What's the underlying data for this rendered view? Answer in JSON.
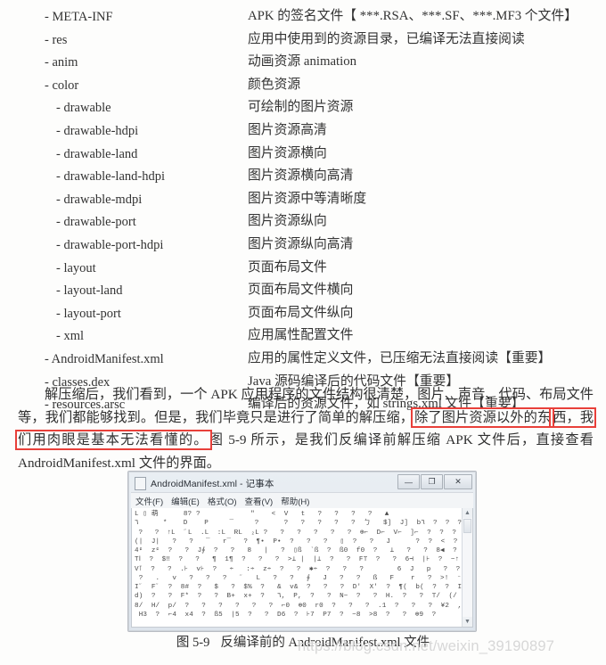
{
  "document": {
    "tree": [
      {
        "level": 1,
        "name": "- META-INF",
        "desc": "APK 的签名文件【 ***.RSA、***.SF、***.MF3 个文件】"
      },
      {
        "level": 1,
        "name": "- res",
        "desc": "应用中使用到的资源目录，已编译无法直接阅读"
      },
      {
        "level": 1,
        "name": "- anim",
        "desc": "动画资源 animation"
      },
      {
        "level": 1,
        "name": "- color",
        "desc": "颜色资源"
      },
      {
        "level": 2,
        "name": "- drawable",
        "desc": "可绘制的图片资源"
      },
      {
        "level": 2,
        "name": "- drawable-hdpi",
        "desc": "图片资源高清"
      },
      {
        "level": 2,
        "name": "- drawable-land",
        "desc": "图片资源横向"
      },
      {
        "level": 2,
        "name": "- drawable-land-hdpi",
        "desc": "图片资源横向高清"
      },
      {
        "level": 2,
        "name": "- drawable-mdpi",
        "desc": "图片资源中等清晰度"
      },
      {
        "level": 2,
        "name": "- drawable-port",
        "desc": "图片资源纵向"
      },
      {
        "level": 2,
        "name": "- drawable-port-hdpi",
        "desc": "图片资源纵向高清"
      },
      {
        "level": 2,
        "name": "- layout",
        "desc": "页面布局文件"
      },
      {
        "level": 2,
        "name": "- layout-land",
        "desc": "页面布局文件横向"
      },
      {
        "level": 2,
        "name": "- layout-port",
        "desc": "页面布局文件纵向"
      },
      {
        "level": 2,
        "name": "- xml",
        "desc": "应用属性配置文件"
      },
      {
        "level": 1,
        "name": "- AndroidManifest.xml",
        "desc": "应用的属性定义文件，已压缩无法直接阅读【重要】"
      },
      {
        "level": 1,
        "name": "- classes.dex",
        "desc": "Java 源码编译后的代码文件【重要】"
      },
      {
        "level": 1,
        "name": "- resources.arsc",
        "desc": "编译后的资源文件，如 strings.xml 文件【重要】"
      }
    ],
    "paragraph": {
      "part1": "解压缩后，我们看到，一个 APK 应用程序的文件结构很清楚，图片、声音、代码、布局文件等，我们都能够找到。但是，我们毕竟只是进行了简单的解压缩，",
      "highlight1": "除了图片资源以外的东",
      "highlight2": "西，我们用肉眼是基本无法看懂的。",
      "part2": "图 5-9 所示，是我们反编译前解压缩 APK 文件后，直接查看 AndroidManifest.xml 文件的界面。"
    },
    "caption": {
      "number": "图 5-9",
      "text": "反编译前的 AndroidManifest.xml 文件"
    },
    "watermark": "https://blog.csdn.net/weixin_39190897",
    "accent_color": "#e8403a"
  },
  "notepad": {
    "title": "AndroidManifest.xml - 记事本",
    "menus": [
      "文件(F)",
      "编辑(E)",
      "格式(O)",
      "查看(V)",
      "帮助(H)"
    ],
    "window_buttons": {
      "minimize": "—",
      "maximize": "❐",
      "close": "✕"
    },
    "scrollbar": {
      "up": "▲",
      "down": "▼"
    },
    "content": "L ▯ 萌      8? ?            \"    <  V   t   ?   ?   ?   ?   ▲\n٦      *    D    P     ¯     ?      ?   ?   ?   ?   ?  ㄅ   $]  J]  b٦  ?  ?  ?\n ?   ?  ↑L  ˝L  .L  :L  RL  ₂L ?   ?   ?   ?   ?   ?  ⊕⌐  D⌐  V⌐  ]⌐  ?  ?  ?\n(|  J|   ?   ?   ‾   r‾   ?  ¶•  P•  ?   ?   ?   ▯  ?   ?   J      ?  ?  <  ?  ?\n4ᶝ  zᶝ  ?   ?  J∮  ?   ?   8   |   ?  ▯ß  `ß  ?  ß0  f0  ?   ⊥   ?   ?  8◀  ?  ?\nTⵏ  ?  $‼  ?   ?   ¶  1¶  ?   ?   ?  >⊥ |  |⊥  ?   ?  F⊤  ?   ?  6⊣  |⊦  ?  −↑\nV⊺  ?   ?  .⊦  v⊦  ?   ÷   :÷  z÷  ?   ?  ✱÷  ?   ?   ?        6  J   p   ?  ?  ?\n ?   .   v   ?   ?   ?   ˝   L   ?   ?   ∮   J   ?   ?   ß   F    r   ?  >!  ⁻!  ?  ?\nI˝  F˝  ?  8#  ?   $   ?  $%  ?   &  v&  ?   ?   ?  D′  X′  ?  ¶(  b(  ?  ?  I)\nd)  ?   ?  F*  ?   ?  B+  x+  ?   ٦,  P,  ?   ?  N−  ?   ?  H.  ?   ?  ⊤/  (/\n8/  H/  p/  ?   ?   ?   ?   ?   ?  ⌐0  ⊕0  r0  ?   ?   ?  .1  ?   ?   ?  ¥2  ,2  ?\n H3  ?  ⌐4  x4  ?  ß5  |5  ?   ?  D6  ?  ⊦7  P7  ?  −8  >8  ?   ?  ⊕9  ?"
  }
}
